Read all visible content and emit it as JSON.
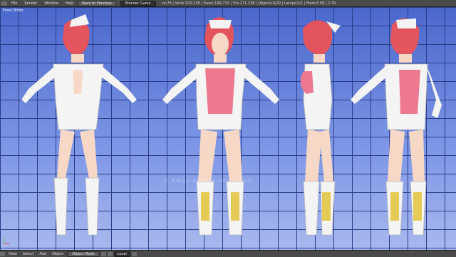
{
  "topbar": {
    "menus": [
      "File",
      "Render",
      "Window",
      "Help"
    ],
    "back_button": "Back to Previous",
    "engine": "Blender Game",
    "stats": "ve:78 | Verts:100,238 | Faces:199,732 | Tris:271,238 | Objects:0/29 | Lamps:0/1 | Mem:8.58 | 2.79"
  },
  "viewport": {
    "label": "Front Ortho",
    "watermark": "© Rdrgz-Sta.deviantart.com"
  },
  "bottombar": {
    "items": [
      "View",
      "Select",
      "Add",
      "Object"
    ],
    "mode": "Object Mode",
    "pivot": "Local"
  },
  "colors": {
    "hair": "#e4545c",
    "skin": "#f7d8c6",
    "outfit": "#f4f4f4",
    "accent": "#ee7890",
    "gold": "#e2c23a"
  },
  "icons": [
    "blender-icon",
    "view-icon",
    "shading-icon",
    "manipulator-icon",
    "layers-icon",
    "axis-gizmo-icon"
  ]
}
